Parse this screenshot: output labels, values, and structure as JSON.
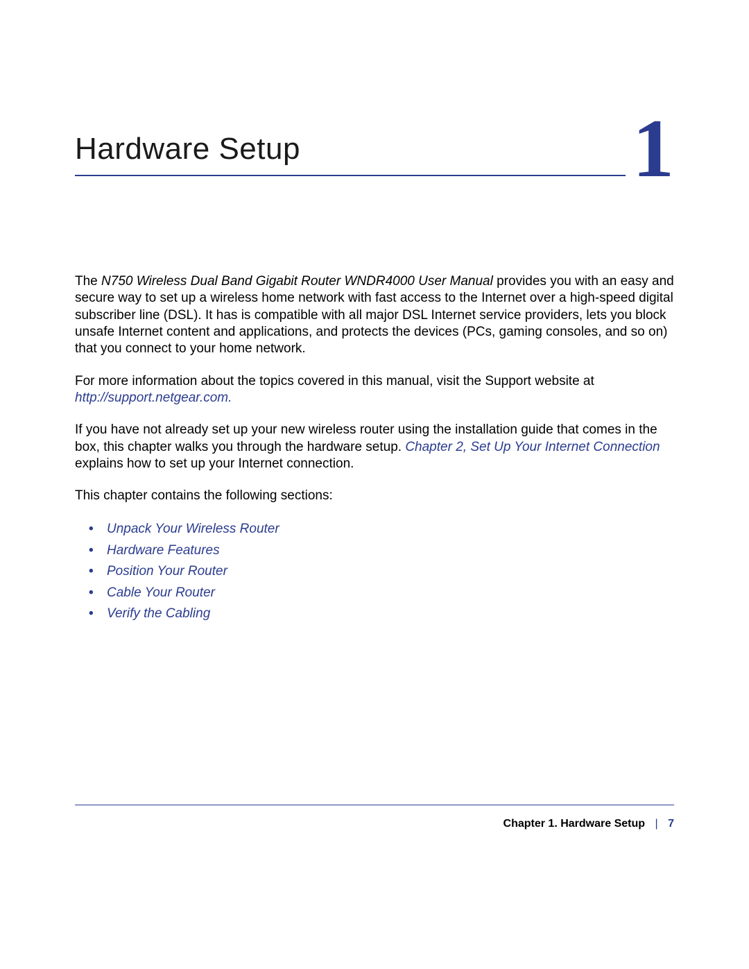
{
  "chapter": {
    "title": "Hardware Setup",
    "number": "1"
  },
  "paragraphs": {
    "p1_pre": "The ",
    "p1_manual": "N750 Wireless Dual Band Gigabit Router WNDR4000 User Manual",
    "p1_post": " provides you with an easy and secure way to set up a wireless home network with fast access to the Internet over a high-speed digital subscriber line (DSL). It has is compatible with all major DSL Internet service providers, lets you block unsafe Internet content and applications, and protects the devices (PCs, gaming consoles, and so on) that you connect to your home network.",
    "p2_pre": "For more information about the topics covered in this manual, visit the Support website at ",
    "p2_link": "http://support.netgear.com",
    "p2_post": ".",
    "p3_pre": "If you have not already set up your new wireless router using the installation guide that comes in the box, this chapter walks you through the hardware setup. ",
    "p3_link": "Chapter 2, Set Up Your Internet Connection",
    "p3_post": " explains how to set up your Internet connection.",
    "p4": "This chapter contains the following sections:"
  },
  "sections": [
    "Unpack Your Wireless Router",
    "Hardware Features",
    "Position Your Router",
    "Cable Your Router",
    "Verify the Cabling"
  ],
  "footer": {
    "label": "Chapter 1.  Hardware Setup",
    "sep": "|",
    "page": "7"
  }
}
